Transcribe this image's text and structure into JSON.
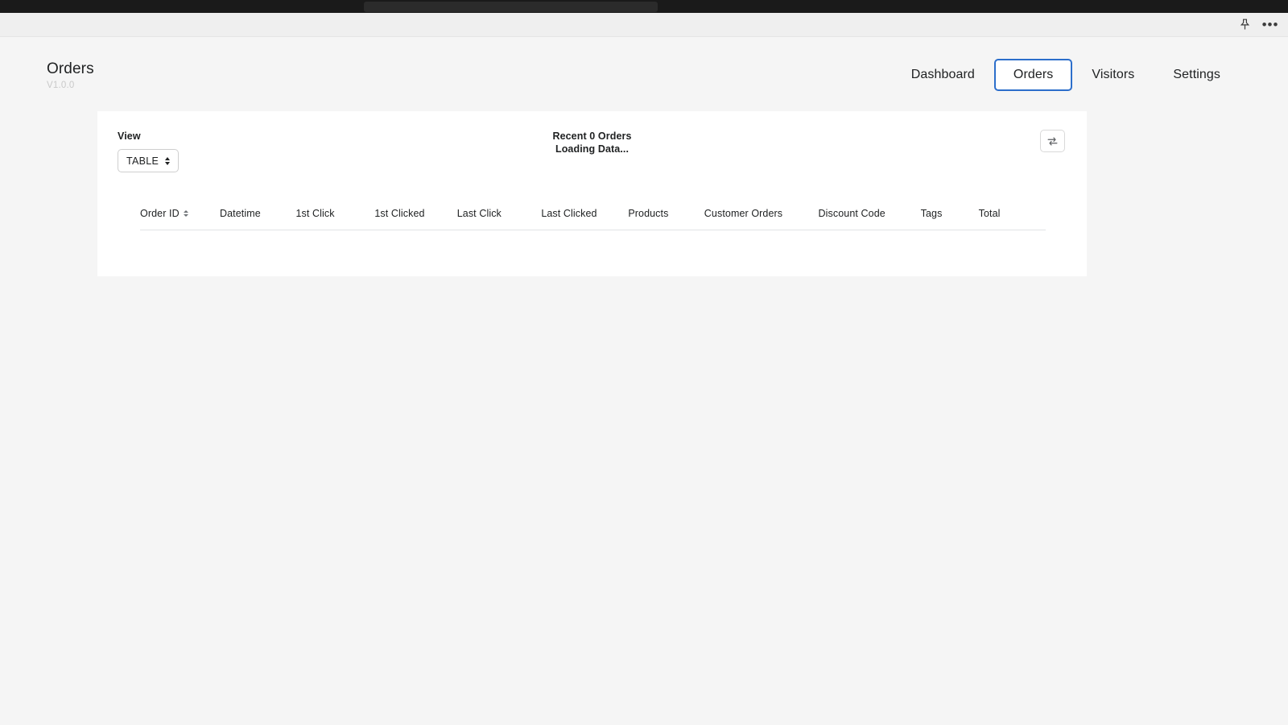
{
  "os_bar": {
    "address_pill": ""
  },
  "chrome": {
    "pin_icon": "pin-icon",
    "more_icon": "•••"
  },
  "brand": {
    "title": "Orders",
    "version": "V1.0.0"
  },
  "nav": {
    "items": [
      {
        "label": "Dashboard",
        "active": false
      },
      {
        "label": "Orders",
        "active": true
      },
      {
        "label": "Visitors",
        "active": false
      },
      {
        "label": "Settings",
        "active": false
      }
    ],
    "active_border_color": "#2c6ecb"
  },
  "toolbar": {
    "view_label": "View",
    "view_value": "TABLE",
    "view_options": [
      "TABLE"
    ],
    "status_primary": "Recent 0 Orders",
    "status_secondary": "Loading Data...",
    "refresh_icon": "refresh-icon"
  },
  "table": {
    "columns": [
      {
        "label": "Order ID",
        "sortable": true
      },
      {
        "label": "Datetime",
        "sortable": false
      },
      {
        "label": "1st Click",
        "sortable": false
      },
      {
        "label": "1st Clicked",
        "sortable": false
      },
      {
        "label": "Last Click",
        "sortable": false
      },
      {
        "label": "Last Clicked",
        "sortable": false
      },
      {
        "label": "Products",
        "sortable": false
      },
      {
        "label": "Customer Orders",
        "sortable": false
      },
      {
        "label": "Discount Code",
        "sortable": false
      },
      {
        "label": "Tags",
        "sortable": false
      },
      {
        "label": "Total",
        "sortable": false
      }
    ],
    "rows": []
  },
  "colors": {
    "page_background": "#f5f5f5",
    "card_background": "#ffffff",
    "chrome_strip": "#efefef",
    "os_bar": "#1a1a1a",
    "accent": "#2c6ecb",
    "text": "#202223",
    "muted_text": "#c9c9c9",
    "rule": "#e1e3e5"
  }
}
